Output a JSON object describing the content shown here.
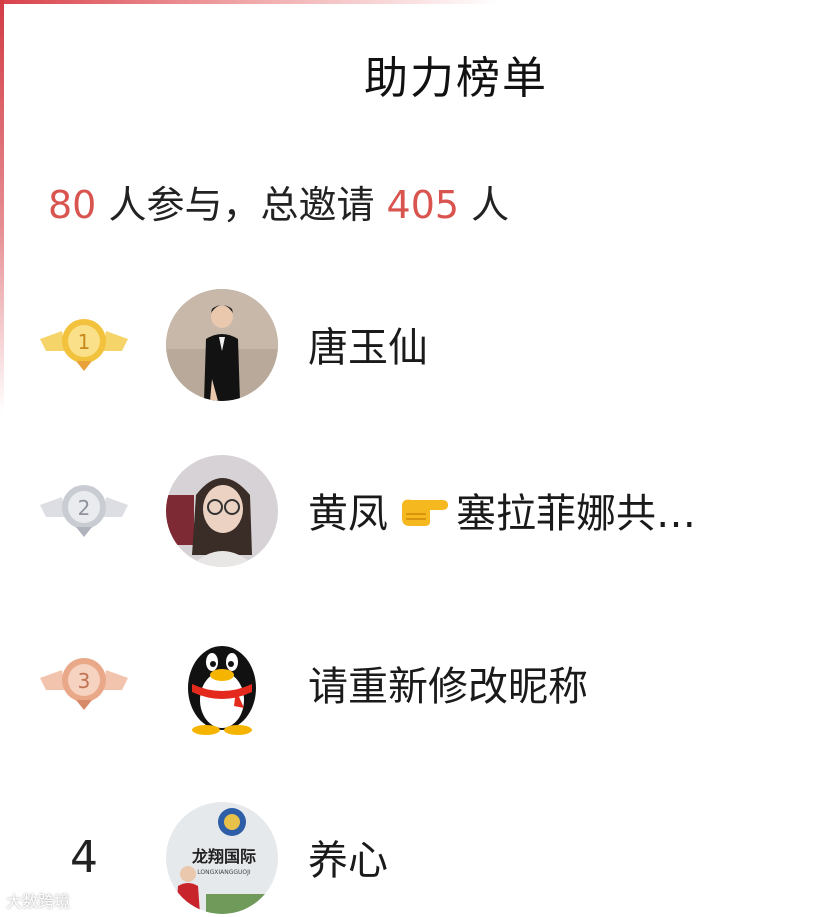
{
  "header": {
    "title": "助力榜单"
  },
  "stats": {
    "participants": "80",
    "participants_suffix": " 人参与，总邀请 ",
    "invited": "405",
    "invited_suffix": " 人"
  },
  "leaderboard": [
    {
      "rank": "1",
      "name": "唐玉仙",
      "medal": "gold",
      "avatar": "woman-in-suit"
    },
    {
      "rank": "2",
      "name_before": "黄凤",
      "name_after": "塞拉菲娜共…",
      "medal": "silver",
      "avatar": "woman-with-glasses",
      "emoji": "pointing-hand-icon"
    },
    {
      "rank": "3",
      "name": "请重新修改昵称",
      "medal": "bronze",
      "avatar": "qq-penguin"
    },
    {
      "rank": "4",
      "name": "养心",
      "avatar": "company-logo-photo",
      "avatar_text": "龙翔国际",
      "avatar_subtext": "LONGXIANGGUOJI"
    }
  ],
  "watermark": "大数跨境",
  "colors": {
    "accent": "#d9534f",
    "gold": "#f2c23c",
    "silver": "#c9ccd3",
    "bronze": "#e9a988"
  }
}
